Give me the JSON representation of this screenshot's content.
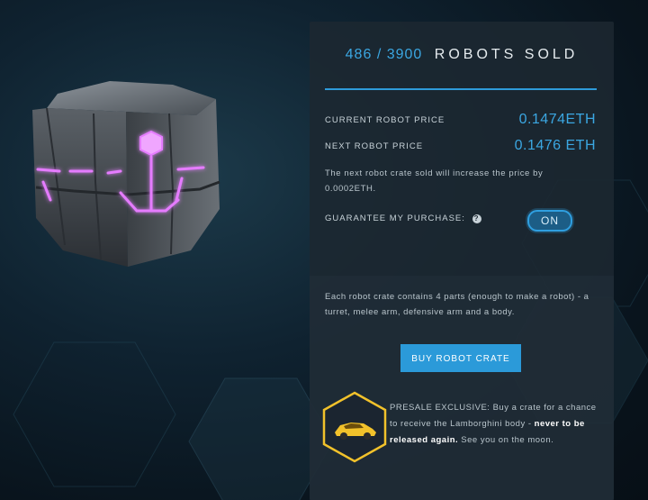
{
  "counter": {
    "sold": "486",
    "separator": "/",
    "total": "3900",
    "label": "ROBOTS SOLD"
  },
  "pricing": {
    "current_label": "CURRENT ROBOT PRICE",
    "current_value": "0.1474ETH",
    "next_label": "NEXT ROBOT PRICE",
    "next_value": "0.1476 ETH",
    "note": "The next robot crate sold will increase the price by 0.0002ETH."
  },
  "guarantee": {
    "label": "GUARANTEE MY PURCHASE:",
    "help_icon": "?",
    "toggle_label": "ON"
  },
  "description": "Each robot crate contains 4 parts (enough to make a robot) - a turret, melee arm, defensive arm and a body.",
  "buy_button": "BUY ROBOT CRATE",
  "presale": {
    "lead": "PRESALE EXCLUSIVE: Buy a crate for a chance to receive the Lamborghini body - ",
    "emphasis": "never to be released again.",
    "tail": " See you on the moon."
  },
  "icons": {
    "crate": "robot-crate-icon",
    "badge": "lamborghini-badge-icon",
    "help": "help-icon"
  },
  "colors": {
    "accent": "#2e9bd9",
    "badge_gold": "#f2c22b",
    "glow": "#e26bff"
  }
}
